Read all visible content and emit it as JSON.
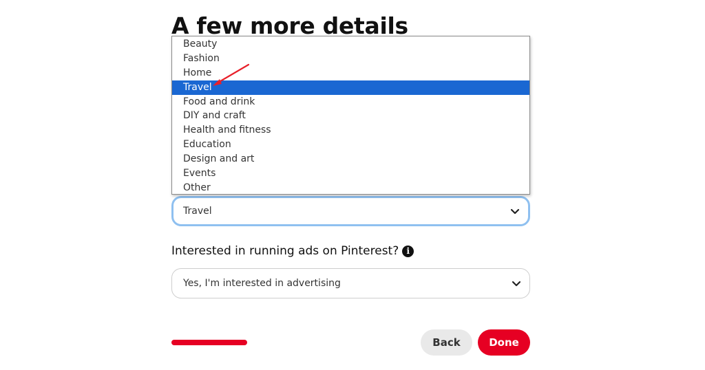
{
  "page": {
    "title": "A few more details"
  },
  "category_dropdown": {
    "options": [
      "Beauty",
      "Fashion",
      "Home",
      "Travel",
      "Food and drink",
      "DIY and craft",
      "Health and fitness",
      "Education",
      "Design and art",
      "Events",
      "Other"
    ],
    "highlighted_option": "Travel",
    "selected_value": "Travel"
  },
  "ads_question": {
    "label": "Interested in running ads on Pinterest?",
    "info_icon_glyph": "i",
    "selected_value": "Yes, I'm interested in advertising"
  },
  "progress": {
    "fraction": 0.22
  },
  "buttons": {
    "back_label": "Back",
    "done_label": "Done"
  },
  "colors": {
    "brand_red": "#e60023",
    "highlight_blue": "#1a67d2",
    "focus_ring": "#8fc0f0",
    "annotation_arrow": "#e8202a"
  }
}
